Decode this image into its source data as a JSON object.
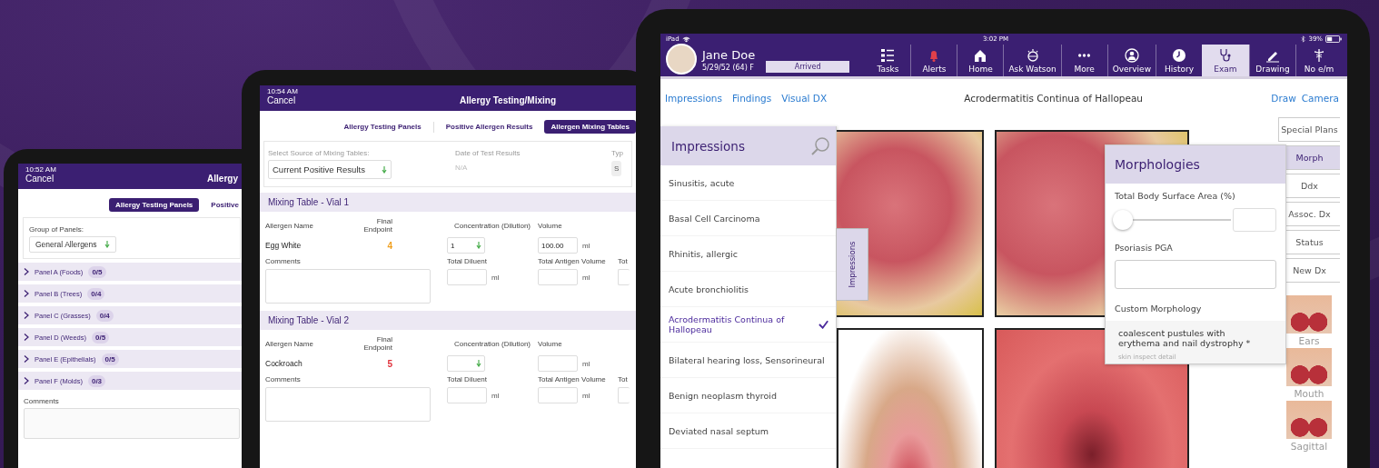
{
  "tablet_1": {
    "status_time": "10:52 AM",
    "cancel": "Cancel",
    "title": "Allergy",
    "tabs": [
      {
        "label": "Allergy Testing Panels",
        "selected": true
      },
      {
        "label": "Positive",
        "selected": false
      }
    ],
    "group_label": "Group of Panels:",
    "group_value": "General Allergens",
    "panels": [
      {
        "name": "Panel A (Foods)",
        "count": "0/5"
      },
      {
        "name": "Panel B (Trees)",
        "count": "0/4"
      },
      {
        "name": "Panel C (Grasses)",
        "count": "0/4"
      },
      {
        "name": "Panel D (Weeds)",
        "count": "0/5"
      },
      {
        "name": "Panel E (Epithelials)",
        "count": "0/5"
      },
      {
        "name": "Panel F (Molds)",
        "count": "0/3"
      }
    ],
    "comments_label": "Comments"
  },
  "tablet_2": {
    "status_time": "10:54 AM",
    "cancel": "Cancel",
    "title": "Allergy Testing/Mixing",
    "tabs": [
      {
        "label": "Allergy Testing Panels",
        "selected": false
      },
      {
        "label": "Positive Allergen Results",
        "selected": false
      },
      {
        "label": "Allergen Mixing Tables",
        "selected": true
      }
    ],
    "source_label": "Select Source of Mixing Tables:",
    "source_value": "Current Positive Results",
    "date_label": "Date of Test Results",
    "date_value": "N/A",
    "type_label": "Typ",
    "type_value": "S",
    "vials": [
      {
        "title": "Mixing Table - Vial 1",
        "col_name": "Allergen Name",
        "col_endpoint": "Final Endpoint",
        "col_conc": "Concentration (Dilution)",
        "col_volume": "Volume",
        "allergen": "Egg White",
        "endpoint": "4",
        "color": "#f0a020",
        "conc_value": "1",
        "volume_value": "100.00",
        "volume_unit": "ml",
        "comments_label": "Comments",
        "diluent_label": "Total Diluent",
        "diluent_unit": "ml",
        "antigen_label": "Total Antigen Volume",
        "antigen_unit": "ml",
        "total_label": "Tot"
      },
      {
        "title": "Mixing Table - Vial 2",
        "col_name": "Allergen Name",
        "col_endpoint": "Final Endpoint",
        "col_conc": "Concentration (Dilution)",
        "col_volume": "Volume",
        "allergen": "Cockroach",
        "endpoint": "5",
        "color": "#e0303a",
        "volume_unit": "ml",
        "comments_label": "Comments",
        "diluent_label": "Total Diluent",
        "diluent_unit": "ml",
        "antigen_label": "Total Antigen Volume",
        "antigen_unit": "ml",
        "total_label": "Tot"
      }
    ]
  },
  "tablet_3": {
    "status": {
      "device": "iPad",
      "time": "3:02 PM",
      "battery": "39%"
    },
    "patient": {
      "name": "Jane Doe",
      "details": "5/29/52 (64) F",
      "visit_status": "Arrived"
    },
    "nav": [
      {
        "label": "Tasks",
        "selected": false
      },
      {
        "label": "Alerts",
        "selected": false
      },
      {
        "label": "Home",
        "selected": false
      },
      {
        "label": "Ask Watson",
        "selected": false
      },
      {
        "label": "More",
        "selected": false
      },
      {
        "label": "Overview",
        "selected": false
      },
      {
        "label": "History",
        "selected": false
      },
      {
        "label": "Exam",
        "selected": true
      },
      {
        "label": "Drawing",
        "selected": false
      },
      {
        "label": "No e/m",
        "selected": false
      }
    ],
    "links": [
      "Impressions",
      "Findings",
      "Visual DX"
    ],
    "exam_title": "Acrodermatitis Continua of Hallopeau",
    "actions": [
      "Draw",
      "Camera"
    ],
    "impressions": {
      "title": "Impressions",
      "tab_label": "Impressions",
      "items": [
        {
          "label": "Sinusitis, acute",
          "selected": false
        },
        {
          "label": "Basal Cell Carcinoma",
          "selected": false
        },
        {
          "label": "Rhinitis, allergic",
          "selected": false
        },
        {
          "label": "Acute bronchiolitis",
          "selected": false
        },
        {
          "label": "Acrodermatitis Continua of Hallopeau",
          "selected": true
        },
        {
          "label": "Bilateral hearing loss, Sensorineural",
          "selected": false
        },
        {
          "label": "Benign neoplasm thyroid",
          "selected": false
        },
        {
          "label": "Deviated nasal septum",
          "selected": false
        }
      ]
    },
    "morphologies": {
      "title": "Morphologies",
      "bsa_label": "Total Body Surface Area (%)",
      "level": 0,
      "pga_label": "Psoriasis PGA",
      "custom_label": "Custom Morphology",
      "custom_text": "coalescent pustules with erythema and nail dystrophy *",
      "custom_note": "skin inspect detail"
    },
    "side_buttons": [
      {
        "label": "Special Plans",
        "selected": false
      },
      {
        "label": "Morph",
        "selected": true
      },
      {
        "label": "Ddx",
        "selected": false
      },
      {
        "label": "Assoc. Dx",
        "selected": false
      },
      {
        "label": "Status",
        "selected": false
      },
      {
        "label": "New Dx",
        "selected": false
      }
    ],
    "thumbnails": [
      "Ears",
      "Mouth",
      "Sagittal"
    ]
  }
}
